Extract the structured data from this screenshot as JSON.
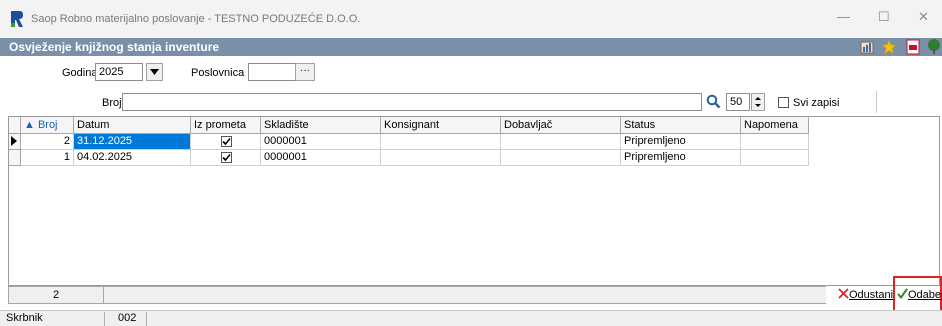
{
  "window": {
    "title": "Saop Robno materijalno poslovanje - TESTNO PODUZEĆE D.O.O.",
    "minimize": "—",
    "maximize": "☐",
    "close": "✕"
  },
  "panel": {
    "title": "Osvježenje knjižnog stanja inventure"
  },
  "filters": {
    "godina_label": "Godina",
    "godina_value": "2025",
    "poslovnica_label": "Poslovnica",
    "poslovnica_value": "",
    "broj_label": "Broj",
    "broj_value": "",
    "limit_value": "50",
    "svi_zapisi_label": "Svi zapisi"
  },
  "grid": {
    "columns": [
      "▲ Broj",
      "Datum",
      "Iz prometa",
      "Skladište",
      "Konsignant",
      "Dobavljač",
      "Status",
      "Napomena"
    ],
    "rows": [
      {
        "broj": "2",
        "datum": "31.12.2025",
        "iz_prometa": true,
        "skladiste": "0000001",
        "konsignant": "",
        "dobavljac": "",
        "status": "Pripremljeno",
        "napomena": ""
      },
      {
        "broj": "1",
        "datum": "04.02.2025",
        "iz_prometa": true,
        "skladiste": "0000001",
        "konsignant": "",
        "dobavljac": "",
        "status": "Pripremljeno",
        "napomena": ""
      }
    ],
    "record_count": "2"
  },
  "actions": {
    "cancel_label": "Odustani",
    "select_label": "Odaberi"
  },
  "status": {
    "label": "Skrbnik",
    "value": "002"
  },
  "colors": {
    "panel_bar": "#7a90a8",
    "selection": "#0078d7",
    "highlight": "#d9262b"
  }
}
